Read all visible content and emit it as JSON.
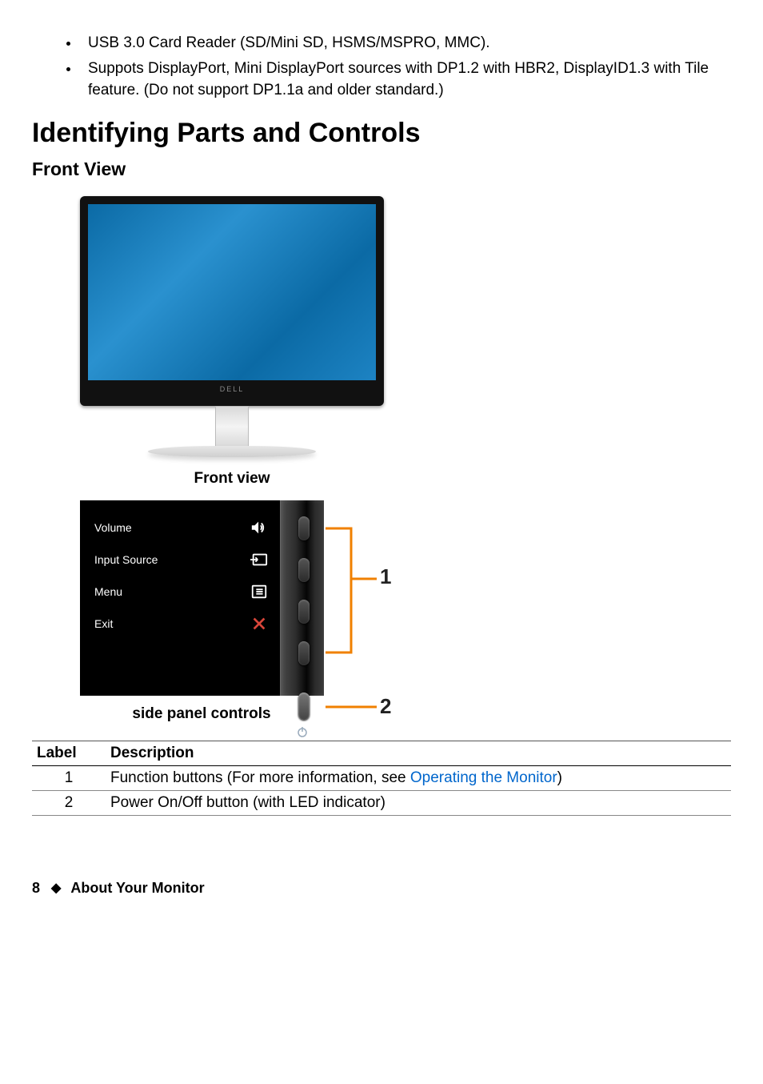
{
  "bullets": [
    "USB 3.0 Card Reader (SD/Mini SD, HSMS/MSPRO, MMC).",
    "Suppots DisplayPort, Mini DisplayPort sources with DP1.2 with HBR2, DisplayID1.3 with Tile feature.  (Do not support DP1.1a and older standard.)"
  ],
  "heading_main": "Identifying Parts and Controls",
  "heading_sub": "Front View",
  "monitor_brand": "DELL",
  "caption_front": "Front view",
  "osd": {
    "items": [
      {
        "label": "Volume",
        "icon": "volume-icon"
      },
      {
        "label": "Input Source",
        "icon": "input-source-icon"
      },
      {
        "label": "Menu",
        "icon": "menu-icon"
      },
      {
        "label": "Exit",
        "icon": "exit-icon"
      }
    ]
  },
  "callouts": {
    "one": "1",
    "two": "2"
  },
  "caption_side": "side panel controls",
  "table": {
    "headers": {
      "label": "Label",
      "desc": "Description"
    },
    "rows": [
      {
        "num": "1",
        "text_before_link": "Function buttons (For more information, see ",
        "link_text": "Operating the Monitor",
        "text_after_link": ")"
      },
      {
        "num": "2",
        "text_before_link": "Power On/Off button (with LED indicator)",
        "link_text": "",
        "text_after_link": ""
      }
    ]
  },
  "footer": {
    "page": "8",
    "section": "About Your Monitor"
  }
}
